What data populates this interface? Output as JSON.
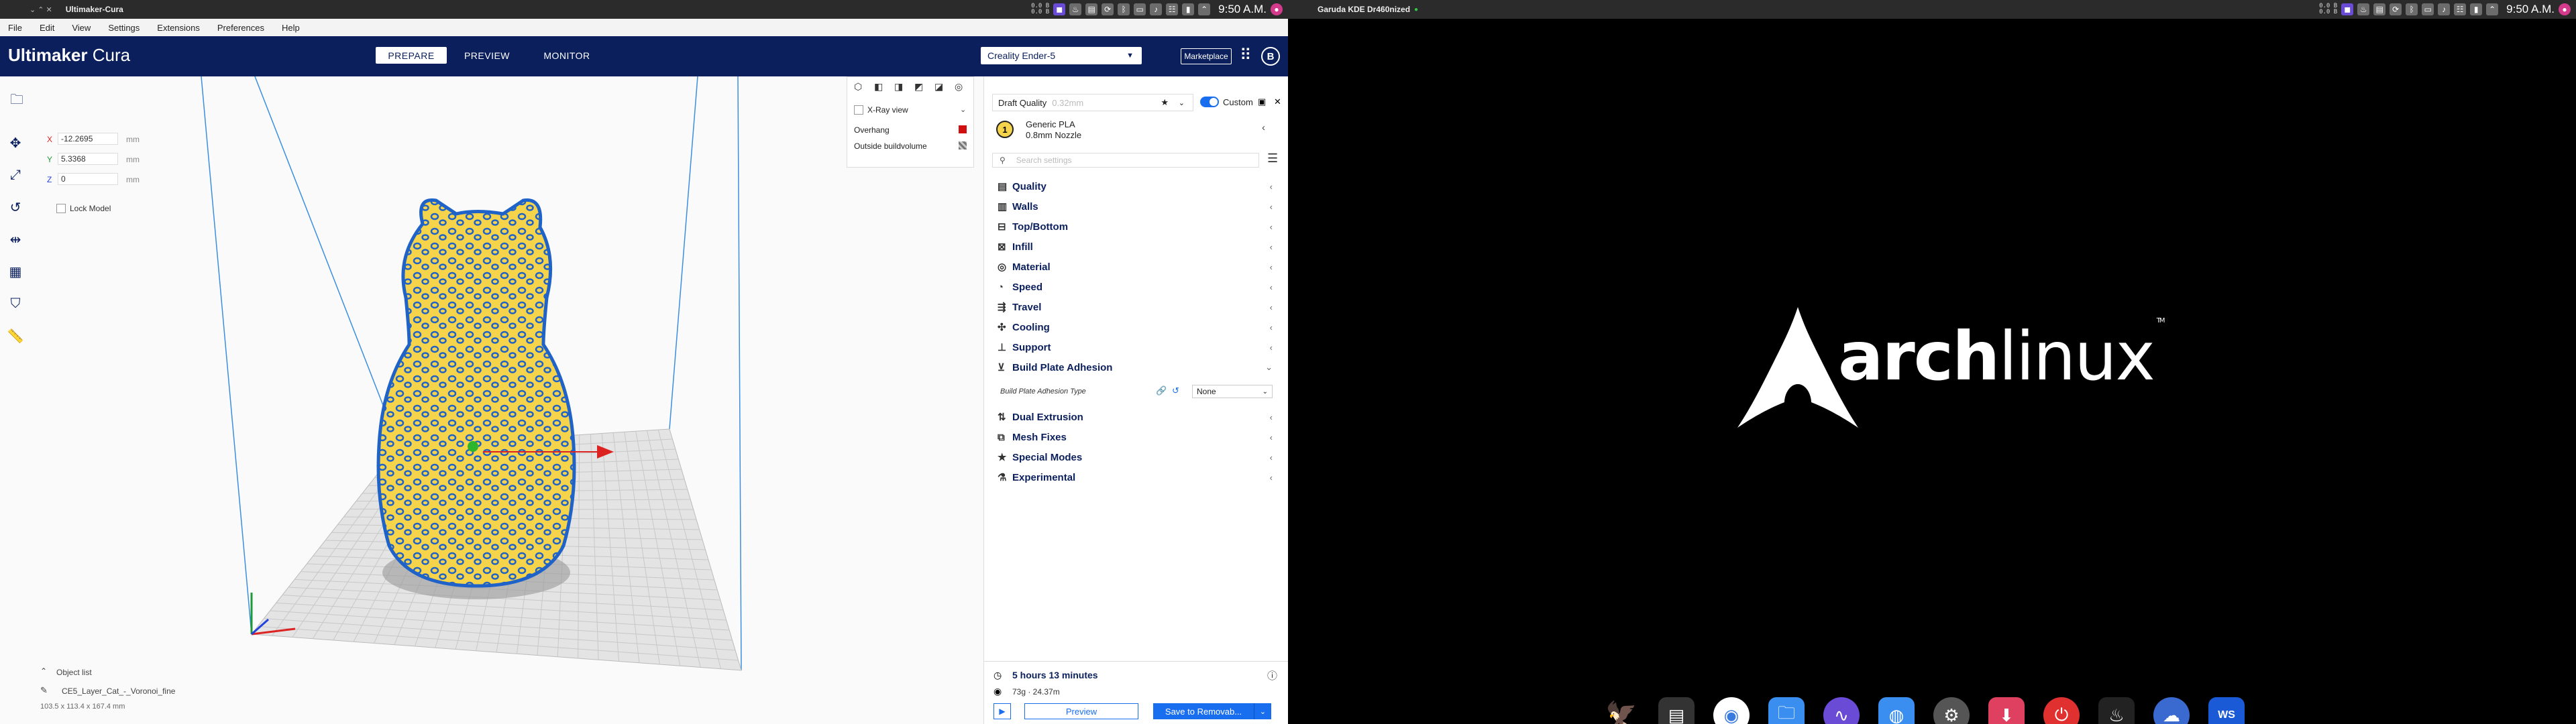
{
  "left_panel": {
    "title": "Ultimaker-Cura",
    "net_up": "0.0 B",
    "net_down": "0.0 B",
    "clock": "9:50 A.M."
  },
  "right_panel": {
    "title": "Garuda KDE Dr460nized",
    "net_up": "0.0 B",
    "net_down": "0.0 B",
    "clock": "9:50 A.M."
  },
  "cura": {
    "menu": [
      "File",
      "Edit",
      "View",
      "Settings",
      "Extensions",
      "Preferences",
      "Help"
    ],
    "logo_bold": "Ultimaker",
    "logo_light": "Cura",
    "stages": [
      "PREPARE",
      "PREVIEW",
      "MONITOR"
    ],
    "printer": "Creality Ender-5",
    "marketplace": "Marketplace",
    "account_initial": "B",
    "transform": {
      "x_label": "X",
      "x": "-12.2695",
      "y_label": "Y",
      "y": "5.3368",
      "z_label": "Z",
      "z": "0",
      "unit": "mm",
      "lock": "Lock Model"
    },
    "view_panel": {
      "xray": "X-Ray view",
      "overhang": "Overhang",
      "outside": "Outside buildvolume"
    },
    "object_list": "Object list",
    "object_name": "CE5_Layer_Cat_-_Voronoi_fine",
    "object_dims": "103.5 x 113.4 x 167.4 mm",
    "profile": "Draft Quality",
    "profile_layer": "0.32mm",
    "custom": "Custom",
    "material": "Generic PLA",
    "nozzle": "0.8mm Nozzle",
    "extruder_num": "1",
    "search_placeholder": "Search settings",
    "categories": [
      "Quality",
      "Walls",
      "Top/Bottom",
      "Infill",
      "Material",
      "Speed",
      "Travel",
      "Cooling",
      "Support",
      "Build Plate Adhesion",
      "Dual Extrusion",
      "Mesh Fixes",
      "Special Modes",
      "Experimental"
    ],
    "adhesion_label": "Build Plate Adhesion Type",
    "adhesion_value": "None",
    "time": "5 hours 13 minutes",
    "material_usage": "73g · 24.37m",
    "preview_btn": "Preview",
    "save_btn": "Save to Removab..."
  },
  "arch": {
    "wordmark_bold": "arch",
    "wordmark_light": "linux",
    "tm": "TM"
  },
  "colors": {
    "cura_navy": "#0a1f5c",
    "cura_blue": "#196ef0",
    "model_yellow": "#f5d34a",
    "model_blue": "#1f63c8"
  }
}
